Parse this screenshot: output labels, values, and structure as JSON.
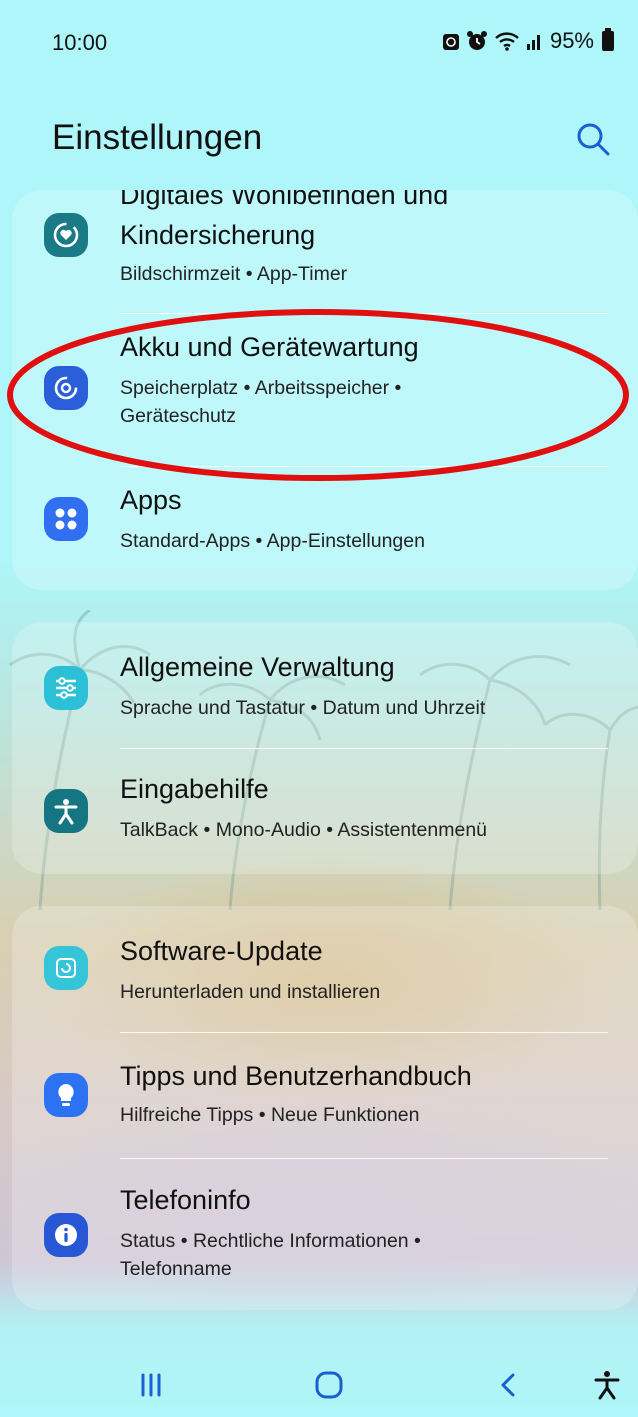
{
  "status": {
    "time": "10:00",
    "battery": "95%"
  },
  "header": {
    "title": "Einstellungen"
  },
  "sections": [
    {
      "items": [
        {
          "title": "Digitales Wohlbefinden und",
          "title2": "Kindersicherung",
          "subtitle": "Bildschirmzeit  •  App-Timer",
          "icon": "digital-wellbeing-icon",
          "color": "#1a7a85"
        },
        {
          "title": "Akku und Gerätewartung",
          "subtitle": "Speicherplatz  •  Arbeitsspeicher  •",
          "subtitle2": "Geräteschutz",
          "icon": "device-care-icon",
          "color": "#2a5fd9"
        },
        {
          "title": "Apps",
          "subtitle": "Standard-Apps  •  App-Einstellungen",
          "icon": "apps-icon",
          "color": "#2f6ff0"
        }
      ]
    },
    {
      "items": [
        {
          "title": "Allgemeine Verwaltung",
          "subtitle": "Sprache und Tastatur  •  Datum und Uhrzeit",
          "icon": "general-management-icon",
          "color": "#2bc0d6"
        },
        {
          "title": "Eingabehilfe",
          "subtitle": "TalkBack  •  Mono-Audio  •  Assistentenmenü",
          "icon": "accessibility-icon",
          "color": "#167582"
        }
      ]
    },
    {
      "items": [
        {
          "title": "Software-Update",
          "subtitle": "Herunterladen und installieren",
          "icon": "software-update-icon",
          "color": "#35c5d8"
        },
        {
          "title": "Tipps und Benutzerhandbuch",
          "subtitle": "Hilfreiche Tipps  •  Neue Funktionen",
          "icon": "tips-icon",
          "color": "#2c72f2"
        },
        {
          "title": "Telefoninfo",
          "subtitle": "Status  •  Rechtliche Informationen  •",
          "subtitle2": "Telefonname",
          "icon": "info-icon",
          "color": "#2857d6"
        }
      ]
    }
  ],
  "annotation": {
    "color": "#e01010"
  }
}
